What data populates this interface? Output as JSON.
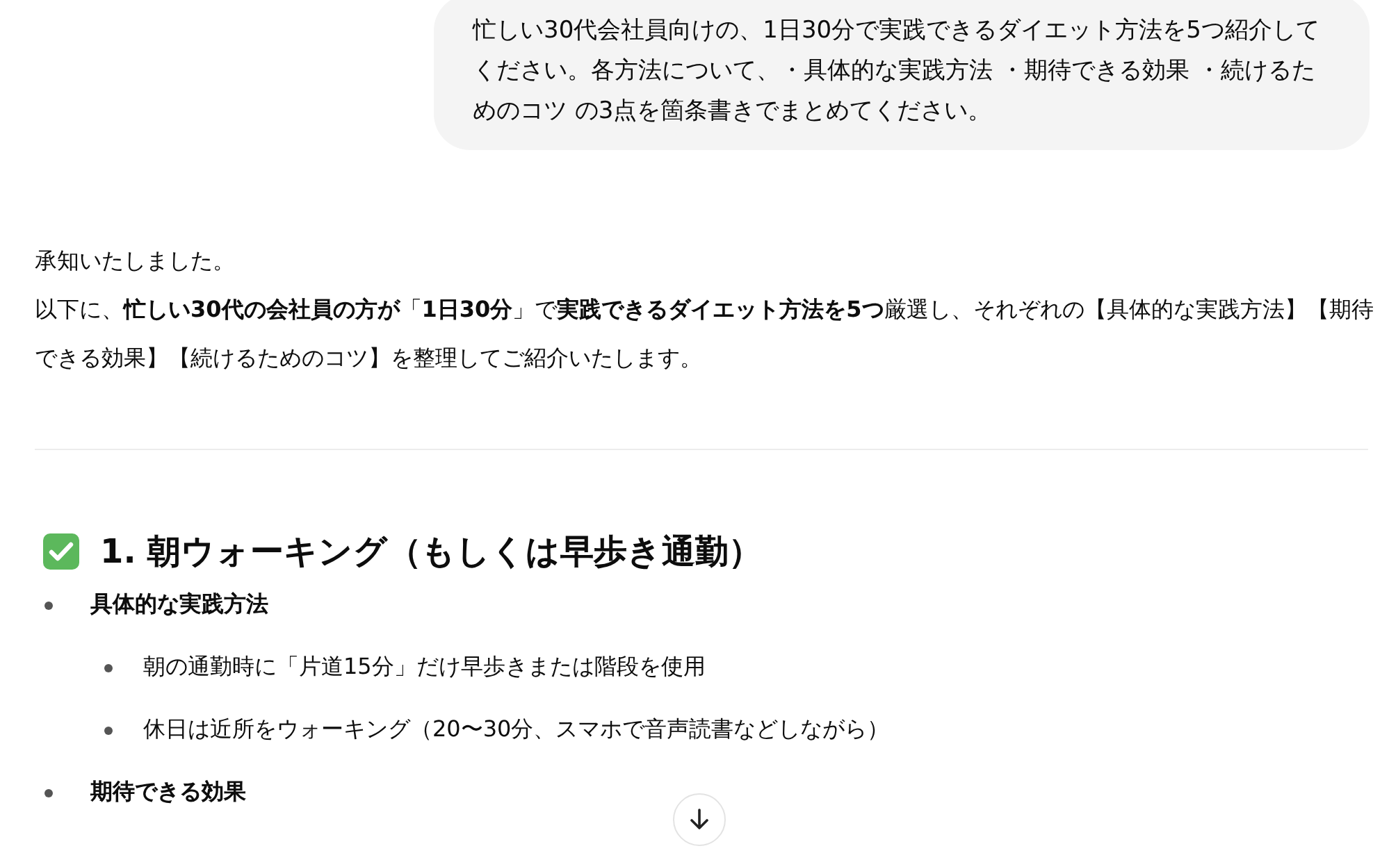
{
  "user_message": "忙しい30代会社員向けの、1日30分で実践できるダイエット方法を5つ紹介してください。各方法について、・具体的な実践方法 ・期待できる効果 ・続けるためのコツ の3点を箇条書きでまとめてください。",
  "response": {
    "paragraphs": [
      "承知いたしました。",
      "以下に、**忙しい30代の会社員の方が**「**1日30分**」で**実践できるダイエット方法を5つ**厳選し、それぞれの【具体的な実践方法】【期待できる効果】【続けるためのコツ】を整理してご紹介いたします。"
    ],
    "section": {
      "heading": "1. 朝ウォーキング（もしくは早歩き通勤）",
      "items": [
        {
          "label": "具体的な実践方法",
          "children": [
            {
              "text": "朝の通勤時に「片道15分」だけ早歩きまたは階段を使用"
            },
            {
              "text": "休日は近所をウォーキング（20〜30分、スマホで音声読書などしながら）"
            }
          ]
        },
        {
          "label": "期待できる効果"
        }
      ]
    }
  }
}
